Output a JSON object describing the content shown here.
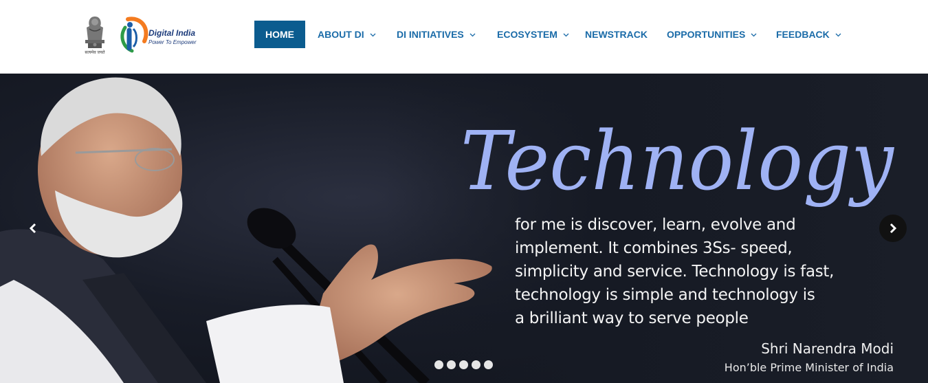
{
  "header": {
    "emblem_motto": "सत्यमेव जयते",
    "logo_title": "Digital India",
    "logo_tagline": "Power To Empower"
  },
  "nav": {
    "items": [
      {
        "label": "HOME",
        "active": true,
        "dropdown": false
      },
      {
        "label": "ABOUT DI",
        "active": false,
        "dropdown": true
      },
      {
        "label": "DI INITIATIVES",
        "active": false,
        "dropdown": true
      },
      {
        "label": "ECOSYSTEM",
        "active": false,
        "dropdown": true
      },
      {
        "label": "NEWSTRACK",
        "active": false,
        "dropdown": false
      },
      {
        "label": "OPPORTUNITIES",
        "active": false,
        "dropdown": true
      },
      {
        "label": "FEEDBACK",
        "active": false,
        "dropdown": true
      }
    ]
  },
  "slide": {
    "headline": "Technology",
    "quote_lines": [
      "for me is discover, learn, evolve and",
      "implement. It combines 3Ss- speed,",
      "simplicity and service. Technology is fast,",
      "technology is simple and technology is",
      "a brilliant way to serve people"
    ],
    "attribution_name": "Shri Narendra Modi",
    "attribution_title": "Hon’ble Prime Minister of India"
  },
  "carousel": {
    "slide_count": 5,
    "prev_icon": "chevron-left-icon",
    "next_icon": "chevron-right-icon"
  },
  "colors": {
    "nav_text": "#1a6ba8",
    "nav_active_bg": "#0b5c8f",
    "headline": "#9fb2f4"
  }
}
